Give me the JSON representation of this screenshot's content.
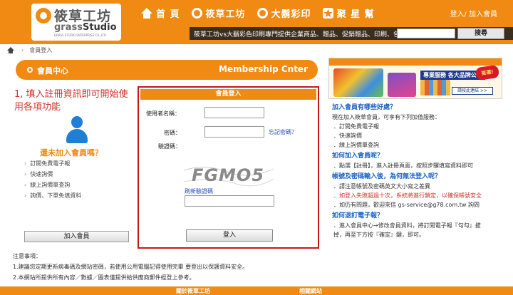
{
  "logo": {
    "text_cn": "筱草工坊",
    "text_en_light": "grass",
    "text_en_bold": "Studio",
    "subtext": "GRASS STUDIO ENTERPRISE CO.,LTD"
  },
  "nav": {
    "items": [
      {
        "label": "首 頁",
        "icon": "home-icon"
      },
      {
        "label": "筱草工坊",
        "icon": "circle-logo-icon"
      },
      {
        "label": "大鬍彩印",
        "icon": "circle-logo-icon"
      },
      {
        "label": "聚 星 幫",
        "icon": "star-icon"
      }
    ],
    "login_link": "登入/ 加入會員"
  },
  "header_bar": {
    "tagline": "筱草工坊vs大鬍彩色印刷專門提供企業商品、贈品、促銷贈品、印刷、包裝",
    "search_placeholder": "",
    "search_button": "搜尋"
  },
  "breadcrumb": {
    "current": "會員登入"
  },
  "member_banner": {
    "title": "會員中心",
    "title_en": "Membership Cnter"
  },
  "left_panel": {
    "step_note": "1, 填入註冊資訊即可開始使用各項功能",
    "not_joined": "還未加入會員嗎？",
    "benefits": [
      "訂閱免費電子報",
      "快速詢價",
      "線上詢價單查詢",
      "詢價、下單免填資料"
    ],
    "join_button": "加入會員"
  },
  "login_form": {
    "title": "會員登入",
    "username_label": "使用者名稱：",
    "username_value": "",
    "password_label": "密碼：",
    "password_value": "",
    "forgot_link": "忘記密碼？",
    "captcha_label": "驗證碼：",
    "captcha_text": "FGMO5",
    "refresh_link": "刷新驗證碼",
    "captcha_value": "",
    "login_button": "登入"
  },
  "notes": {
    "heading": "注意事項：",
    "items": [
      "1.建議您定期更新病毒碼及網站密碼，若使用公用電腦記得使用完畢 要登出以保護資料安全。",
      "2.本網站所提供所有內容／數據／圖表僅提供給供應商郵件經登上參考。"
    ]
  },
  "ad": {
    "title": "專業服務 各大品牌公司",
    "badge": "首選!",
    "button": "請按此連結 >>"
  },
  "faq": {
    "q1": "加入會員有哪些好處？",
    "q1_intro": "現在加入筱草會員，可享有下列加值服務：",
    "q1_items": [
      "．訂閱免費電子報",
      "．快速詢價",
      "．線上詢價單查詢"
    ],
    "q2": "如何加入會員呢？",
    "q2_text": "．點選【註冊】，進入註冊頁面，按照步驟填寫資料即可",
    "q3": "帳號及密碼輸入後，為何無法登入呢？",
    "q3_items": [
      "．請注意帳號及密碼英文大小寫之差異",
      "．如登入失敗超過十次，系統將進行鎖定，以確保帳號安全",
      "．如仍有問題，歡迎來信 gs-service@g78.com.tw 詢問"
    ],
    "q4": "如何退訂電子報？",
    "q4_items": [
      "．進入會員中心→修改會員資料，將訂閱電子報『勾勾』拔",
      "掉，再至下方按『確定』鍵，即可。"
    ]
  },
  "footer": {
    "left_link": "關於筱草工坊",
    "right_link": "相關網站"
  },
  "colors": {
    "brand_orange": "#f08a12",
    "alert_red": "#c7161b",
    "link_blue": "#1a62c4"
  }
}
